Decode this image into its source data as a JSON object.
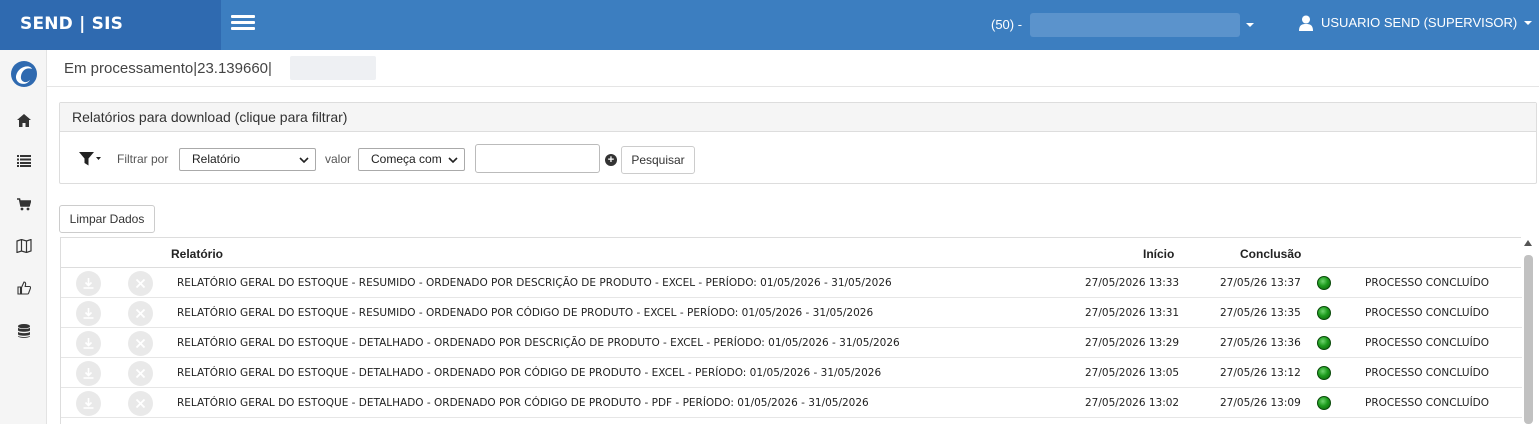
{
  "app": {
    "brand": "SEND | SIS"
  },
  "topbar": {
    "company_prefix": "(50) -",
    "user_name": "USUARIO SEND (SUPERVISOR)"
  },
  "sidebar": {
    "items": [
      {
        "icon": "logo-icon"
      },
      {
        "icon": "home-icon"
      },
      {
        "icon": "list-icon"
      },
      {
        "icon": "cart-icon"
      },
      {
        "icon": "map-icon"
      },
      {
        "icon": "thumbs-up-icon"
      },
      {
        "icon": "database-icon"
      }
    ]
  },
  "breadcrumb": {
    "text": "Em processamento|23.139660|"
  },
  "panel": {
    "title": "Relatórios para download (clique para filtrar)"
  },
  "filter": {
    "filter_by_label": "Filtrar por",
    "field_value": "Relatório",
    "value_label": "valor",
    "operator_value": "Começa com",
    "input_value": "",
    "search_label": "Pesquisar"
  },
  "clear_label": "Limpar Dados",
  "table": {
    "headers": {
      "report": "Relatório",
      "start": "Início",
      "end": "Conclusão"
    },
    "rows": [
      {
        "report": "RELATÓRIO GERAL DO ESTOQUE - RESUMIDO - ORDENADO POR DESCRIÇÃO DE PRODUTO - EXCEL - PERÍODO: 01/05/2026 - 31/05/2026",
        "start": "27/05/2026 13:33",
        "end": "27/05/26 13:37",
        "status": "PROCESSO CONCLUÍDO"
      },
      {
        "report": "RELATÓRIO GERAL DO ESTOQUE - RESUMIDO - ORDENADO POR CÓDIGO DE PRODUTO - EXCEL - PERÍODO: 01/05/2026 - 31/05/2026",
        "start": "27/05/2026 13:31",
        "end": "27/05/26 13:35",
        "status": "PROCESSO CONCLUÍDO"
      },
      {
        "report": "RELATÓRIO GERAL DO ESTOQUE - DETALHADO - ORDENADO POR DESCRIÇÃO DE PRODUTO - EXCEL - PERÍODO: 01/05/2026 - 31/05/2026",
        "start": "27/05/2026 13:29",
        "end": "27/05/26 13:36",
        "status": "PROCESSO CONCLUÍDO"
      },
      {
        "report": "RELATÓRIO GERAL DO ESTOQUE - DETALHADO - ORDENADO POR CÓDIGO DE PRODUTO - EXCEL - PERÍODO: 01/05/2026 - 31/05/2026",
        "start": "27/05/2026 13:05",
        "end": "27/05/26 13:12",
        "status": "PROCESSO CONCLUÍDO"
      },
      {
        "report": "RELATÓRIO GERAL DO ESTOQUE - DETALHADO - ORDENADO POR CÓDIGO DE PRODUTO - PDF - PERÍODO: 01/05/2026 - 31/05/2026",
        "start": "27/05/2026 13:02",
        "end": "27/05/26 13:09",
        "status": "PROCESSO CONCLUÍDO"
      }
    ]
  },
  "colors": {
    "topbar": "#3c7ec0",
    "brand_bg": "#2f6ab0",
    "status_ok": "#1e9c1e"
  }
}
